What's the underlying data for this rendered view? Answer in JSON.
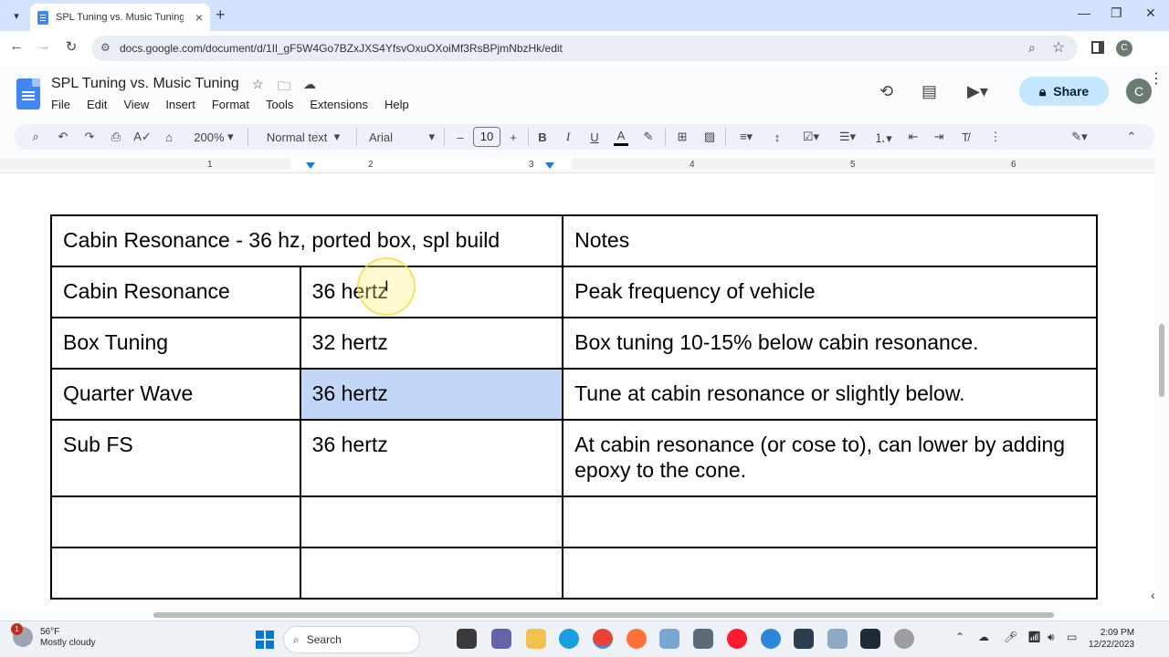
{
  "browser": {
    "tab_title": "SPL Tuning vs. Music Tuning - G",
    "url": "docs.google.com/document/d/1Il_gF5W4Go7BZxJXS4YfsvOxuOXoiMf3RsBPjmNbzHk/edit",
    "profile_initial": "C"
  },
  "doc": {
    "title": "SPL Tuning vs. Music Tuning",
    "menu": [
      "File",
      "Edit",
      "View",
      "Insert",
      "Format",
      "Tools",
      "Extensions",
      "Help"
    ],
    "share_label": "Share",
    "user_initial": "C"
  },
  "toolbar": {
    "zoom": "200%",
    "style": "Normal text",
    "font": "Arial",
    "font_size": "10"
  },
  "ruler": {
    "numbers": [
      "1",
      "2",
      "3",
      "4",
      "5",
      "6"
    ]
  },
  "table": {
    "header": {
      "left": "Cabin Resonance - 36 hz, ported box, spl build",
      "right": "Notes"
    },
    "rows": [
      {
        "label": "Cabin Resonance",
        "value": "36 hertz",
        "note": "Peak frequency of vehicle"
      },
      {
        "label": "Box Tuning",
        "value": "32 hertz",
        "note": "Box tuning 10-15% below cabin resonance."
      },
      {
        "label": "Quarter Wave",
        "value": "36 hertz",
        "note": "Tune at cabin resonance or slightly below."
      },
      {
        "label": "Sub FS",
        "value": "36 hertz",
        "note": "At cabin resonance (or cose to), can lower by adding epoxy to the cone."
      },
      {
        "label": "",
        "value": "",
        "note": ""
      },
      {
        "label": "",
        "value": "",
        "note": ""
      }
    ]
  },
  "taskbar": {
    "weather_temp": "56°F",
    "weather_desc": "Mostly cloudy",
    "weather_badge": "1",
    "search_label": "Search",
    "time": "2:09 PM",
    "date": "12/22/2023"
  }
}
